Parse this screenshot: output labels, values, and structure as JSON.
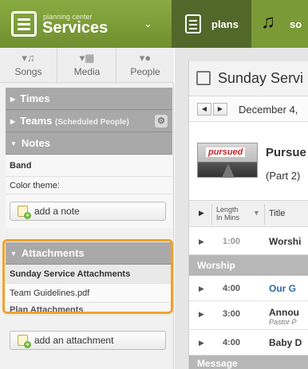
{
  "header": {
    "brand_small": "planning center",
    "brand_big": "Services",
    "brand_chevron": "⌄",
    "tabs": [
      {
        "label": "plans",
        "icon": "plans-icon"
      },
      {
        "label": "so",
        "icon": "music-note-icon"
      }
    ],
    "accent": "#7a9a37"
  },
  "sidebar": {
    "icons": [
      {
        "label": "Songs",
        "icon": "music-note-icon"
      },
      {
        "label": "Media",
        "icon": "film-icon"
      },
      {
        "label": "People",
        "icon": "person-icon"
      }
    ],
    "sections": {
      "times": "Times",
      "teams": "Teams",
      "teams_sub": "(Scheduled People)",
      "notes": "Notes",
      "attachments": "Attachments"
    },
    "notes_rows": [
      "Band",
      "Color theme:"
    ],
    "add_note": "add a note",
    "attachments_group": "Sunday Service Attachments",
    "attachment_file": "Team Guidelines.pdf",
    "plan_attachments": "Plan Attachments",
    "add_attachment": "add an attachment",
    "highlight_color": "#f0a22d"
  },
  "main": {
    "title": "Sunday Servi",
    "date": "December 4,",
    "plan_image_word": "pursued",
    "plan_title": "Pursue",
    "plan_subtitle": "(Part 2)",
    "columns": {
      "length": "Length\nIn Mins",
      "title": "Title"
    },
    "rows": [
      {
        "kind": "item",
        "length": "1:00",
        "title": "Worshi"
      },
      {
        "kind": "header",
        "title": "Worship"
      },
      {
        "kind": "item",
        "length": "4:00",
        "title": "Our G"
      },
      {
        "kind": "item",
        "length": "3:00",
        "title": "Annou",
        "sub": "Pastor P"
      },
      {
        "kind": "item",
        "length": "4:00",
        "title": "Baby D"
      },
      {
        "kind": "header",
        "title": "Message"
      }
    ]
  }
}
